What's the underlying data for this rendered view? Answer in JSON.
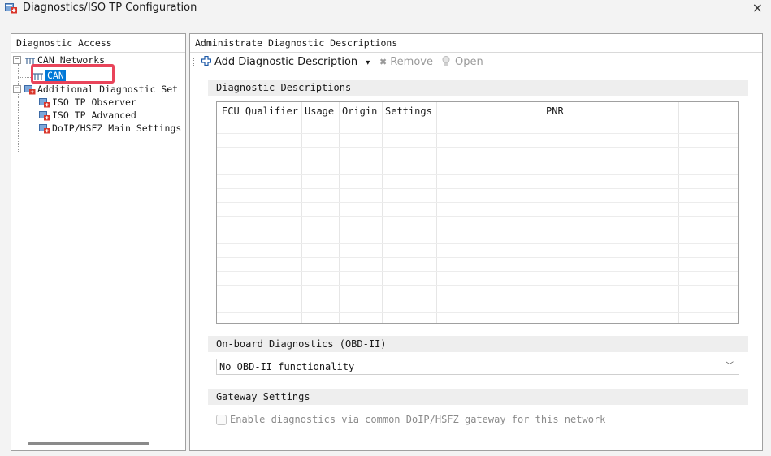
{
  "window": {
    "title": "Diagnostics/ISO TP Configuration",
    "close_glyph": "×"
  },
  "left_panel": {
    "header": "Diagnostic Access",
    "tree": {
      "can_networks": {
        "label": "CAN Networks",
        "icon": "network-icon",
        "expander": "−"
      },
      "can": {
        "label": "CAN",
        "icon": "network-icon"
      },
      "additional": {
        "label": "Additional Diagnostic Set",
        "icon": "settings-doc-icon",
        "expander": "−"
      },
      "iso_tp_observer": {
        "label": "ISO TP Observer",
        "icon": "settings-doc-icon"
      },
      "iso_tp_advanced": {
        "label": "ISO TP Advanced",
        "icon": "settings-doc-icon"
      },
      "doip": {
        "label": "DoIP/HSFZ Main Settings",
        "icon": "settings-doc-icon"
      }
    }
  },
  "right_panel": {
    "header": "Administrate Diagnostic Descriptions",
    "toolbar": {
      "add_label": "Add Diagnostic Description",
      "add_dropdown_glyph": "▾",
      "remove_label": "Remove",
      "open_label": "Open"
    },
    "descriptions": {
      "section_title": "Diagnostic Descriptions",
      "columns": [
        "ECU Qualifier",
        "Usage",
        "Origin",
        "Settings",
        "PNR"
      ]
    },
    "obd": {
      "section_title": "On-board Diagnostics (OBD-II)",
      "selected_value": "No OBD-II functionality"
    },
    "gateway": {
      "section_title": "Gateway Settings",
      "checkbox_label": "Enable diagnostics via common DoIP/HSFZ gateway for this network",
      "checked": false
    }
  },
  "colors": {
    "selection": "#0078d7",
    "highlight_box": "#e9445a",
    "add_icon": "#1e5aa8"
  }
}
